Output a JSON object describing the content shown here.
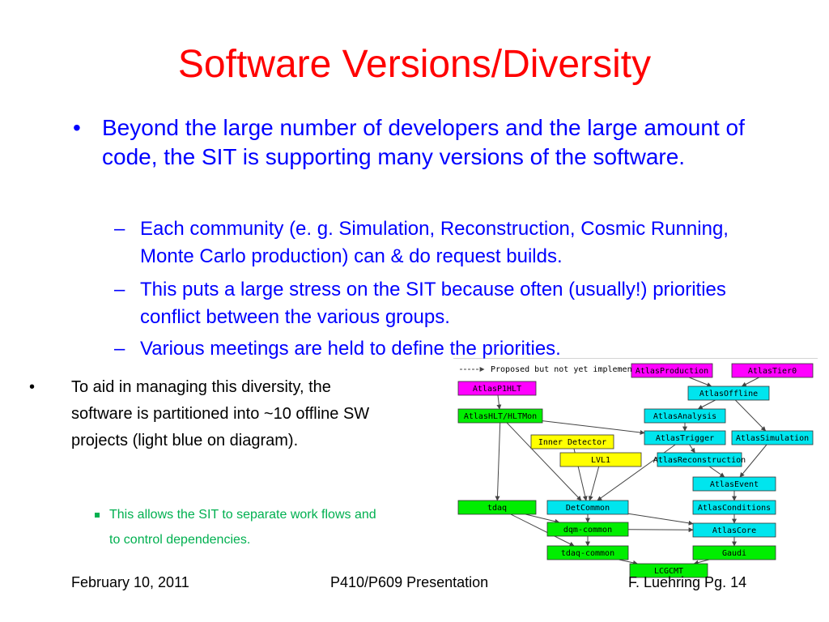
{
  "slide": {
    "title": "Software Versions/Diversity",
    "bullet1": "Beyond the large number of developers and the large amount of code, the SIT is supporting many versions of the software.",
    "sub_bullets": [
      "Each community (e. g. Simulation, Reconstruction, Cosmic Running, Monte Carlo production) can & do request builds.",
      "This puts a large stress on the SIT because often (usually!) priorities conflict between the various groups.",
      "Various meetings are held to define the priorities."
    ],
    "bullet2": "To aid in managing this diversity, the software is partitioned into ~10 offline SW projects (light blue on diagram).",
    "bullet3": "This allows the SIT to separate work flows and to control dependencies.",
    "footer": {
      "date": "February 10, 2011",
      "presentation": "P410/P609 Presentation",
      "author_page": "F. Luehring Pg. 14"
    }
  },
  "diagram": {
    "legend": "Proposed but not yet implemented",
    "colors": {
      "magenta": "#ff00ff",
      "green": "#00ee00",
      "cyan": "#00e5ee",
      "yellow": "#ffff00",
      "arrow": "#444444",
      "bullet_blue": "#0000ff",
      "title_red": "#ff0000",
      "sub_green": "#00b050"
    },
    "nodes": [
      {
        "id": "AtlasProduction",
        "label": "AtlasProduction",
        "color": "magenta"
      },
      {
        "id": "AtlasTier0",
        "label": "AtlasTier0",
        "color": "magenta"
      },
      {
        "id": "AtlasP1HLT",
        "label": "AtlasP1HLT",
        "color": "magenta"
      },
      {
        "id": "AtlasOffline",
        "label": "AtlasOffline",
        "color": "cyan"
      },
      {
        "id": "AtlasHLT",
        "label": "AtlasHLT/HLTMon",
        "color": "green"
      },
      {
        "id": "AtlasAnalysis",
        "label": "AtlasAnalysis",
        "color": "cyan"
      },
      {
        "id": "InnerDetector",
        "label": "Inner Detector",
        "color": "yellow"
      },
      {
        "id": "AtlasTrigger",
        "label": "AtlasTrigger",
        "color": "cyan"
      },
      {
        "id": "AtlasSimulation",
        "label": "AtlasSimulation",
        "color": "cyan"
      },
      {
        "id": "LVL1",
        "label": "LVL1",
        "color": "yellow"
      },
      {
        "id": "AtlasReconstruction",
        "label": "AtlasReconstruction",
        "color": "cyan"
      },
      {
        "id": "AtlasEvent",
        "label": "AtlasEvent",
        "color": "cyan"
      },
      {
        "id": "tdaq",
        "label": "tdaq",
        "color": "green"
      },
      {
        "id": "DetCommon",
        "label": "DetCommon",
        "color": "cyan"
      },
      {
        "id": "AtlasConditions",
        "label": "AtlasConditions",
        "color": "cyan"
      },
      {
        "id": "dqmcommon",
        "label": "dqm-common",
        "color": "green"
      },
      {
        "id": "AtlasCore",
        "label": "AtlasCore",
        "color": "cyan"
      },
      {
        "id": "tdaqcommon",
        "label": "tdaq-common",
        "color": "green"
      },
      {
        "id": "Gaudi",
        "label": "Gaudi",
        "color": "green"
      },
      {
        "id": "LCGCMT",
        "label": "LCGCMT",
        "color": "green"
      }
    ],
    "edges": [
      [
        "AtlasProduction",
        "AtlasOffline"
      ],
      [
        "AtlasTier0",
        "AtlasOffline"
      ],
      [
        "AtlasOffline",
        "AtlasAnalysis"
      ],
      [
        "AtlasOffline",
        "AtlasSimulation"
      ],
      [
        "AtlasP1HLT",
        "AtlasHLT"
      ],
      [
        "AtlasHLT",
        "AtlasTrigger"
      ],
      [
        "AtlasHLT",
        "tdaq"
      ],
      [
        "AtlasHLT",
        "DetCommon"
      ],
      [
        "AtlasAnalysis",
        "AtlasTrigger"
      ],
      [
        "AtlasTrigger",
        "AtlasReconstruction"
      ],
      [
        "AtlasTrigger",
        "DetCommon"
      ],
      [
        "AtlasSimulation",
        "AtlasEvent"
      ],
      [
        "AtlasReconstruction",
        "AtlasEvent"
      ],
      [
        "InnerDetector",
        "DetCommon"
      ],
      [
        "LVL1",
        "DetCommon"
      ],
      [
        "AtlasEvent",
        "AtlasConditions"
      ],
      [
        "AtlasConditions",
        "AtlasCore"
      ],
      [
        "AtlasCore",
        "Gaudi"
      ],
      [
        "DetCommon",
        "dqmcommon"
      ],
      [
        "DetCommon",
        "AtlasCore"
      ],
      [
        "tdaq",
        "dqmcommon"
      ],
      [
        "tdaq",
        "tdaqcommon"
      ],
      [
        "dqmcommon",
        "tdaqcommon"
      ],
      [
        "dqmcommon",
        "AtlasCore"
      ],
      [
        "tdaqcommon",
        "LCGCMT"
      ],
      [
        "Gaudi",
        "LCGCMT"
      ]
    ]
  }
}
